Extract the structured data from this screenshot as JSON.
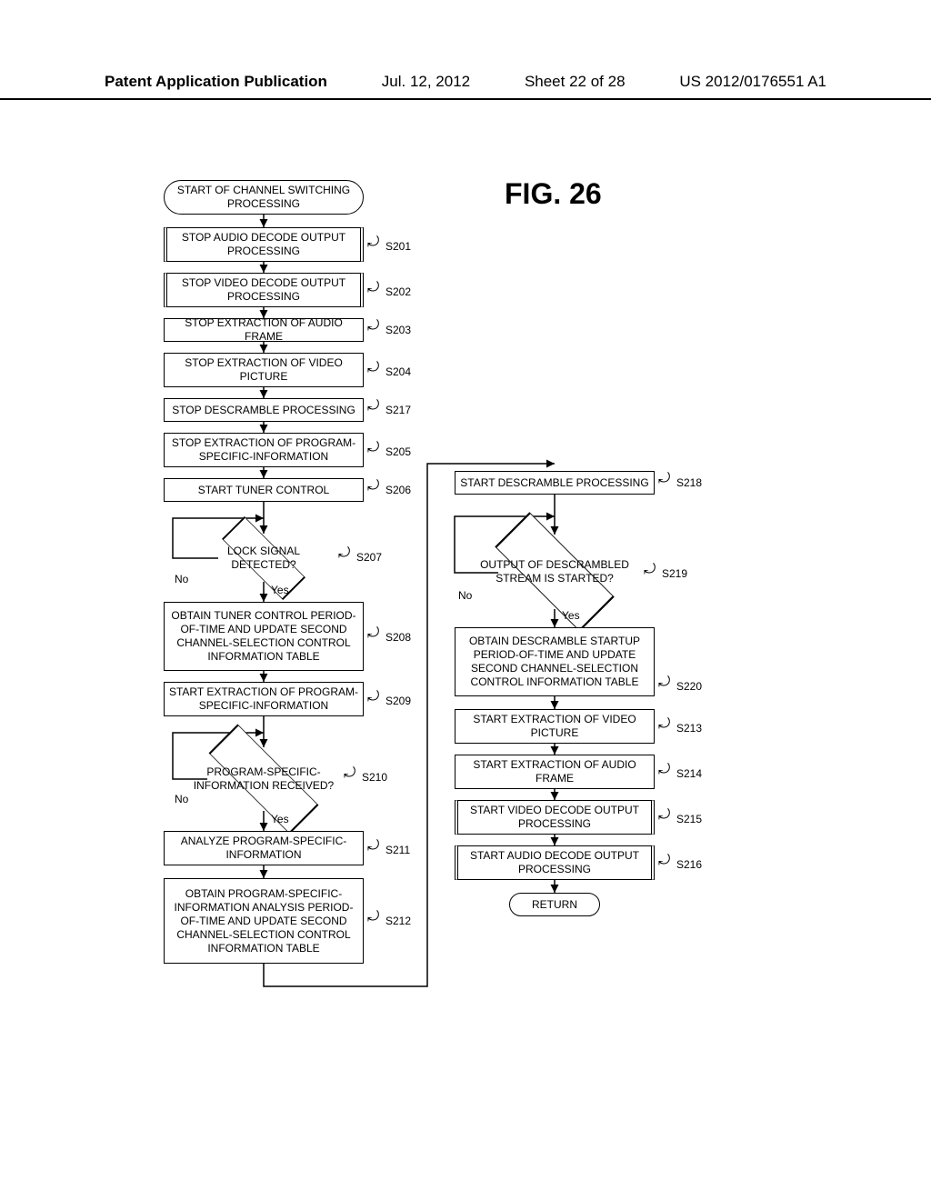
{
  "header": {
    "pub": "Patent Application Publication",
    "date": "Jul. 12, 2012",
    "sheet": "Sheet 22 of 28",
    "docnum": "US 2012/0176551 A1"
  },
  "fig_title": "FIG. 26",
  "terminals": {
    "start": "START OF CHANNEL SWITCHING PROCESSING",
    "return": "RETURN"
  },
  "steps": {
    "s201": {
      "label": "STOP AUDIO DECODE OUTPUT PROCESSING",
      "num": "S201"
    },
    "s202": {
      "label": "STOP VIDEO DECODE OUTPUT PROCESSING",
      "num": "S202"
    },
    "s203": {
      "label": "STOP EXTRACTION OF AUDIO FRAME",
      "num": "S203"
    },
    "s204": {
      "label": "STOP EXTRACTION OF VIDEO PICTURE",
      "num": "S204"
    },
    "s217": {
      "label": "STOP DESCRAMBLE PROCESSING",
      "num": "S217"
    },
    "s205": {
      "label": "STOP EXTRACTION OF PROGRAM-SPECIFIC-INFORMATION",
      "num": "S205"
    },
    "s206": {
      "label": "START TUNER CONTROL",
      "num": "S206"
    },
    "s207": {
      "label": "LOCK SIGNAL DETECTED?",
      "num": "S207"
    },
    "s208": {
      "label": "OBTAIN TUNER CONTROL PERIOD-OF-TIME AND UPDATE SECOND CHANNEL-SELECTION CONTROL INFORMATION TABLE",
      "num": "S208"
    },
    "s209": {
      "label": "START EXTRACTION OF PROGRAM-SPECIFIC-INFORMATION",
      "num": "S209"
    },
    "s210": {
      "label": "PROGRAM-SPECIFIC-INFORMATION RECEIVED?",
      "num": "S210"
    },
    "s211": {
      "label": "ANALYZE PROGRAM-SPECIFIC-INFORMATION",
      "num": "S211"
    },
    "s212": {
      "label": "OBTAIN PROGRAM-SPECIFIC-INFORMATION ANALYSIS PERIOD-OF-TIME AND UPDATE SECOND CHANNEL-SELECTION CONTROL INFORMATION TABLE",
      "num": "S212"
    },
    "s218": {
      "label": "START DESCRAMBLE PROCESSING",
      "num": "S218"
    },
    "s219": {
      "label": "OUTPUT OF DESCRAMBLED STREAM IS STARTED?",
      "num": "S219"
    },
    "s220": {
      "label": "OBTAIN DESCRAMBLE STARTUP PERIOD-OF-TIME AND UPDATE SECOND CHANNEL-SELECTION CONTROL INFORMATION TABLE",
      "num": "S220"
    },
    "s213": {
      "label": "START EXTRACTION OF VIDEO PICTURE",
      "num": "S213"
    },
    "s214": {
      "label": "START EXTRACTION OF AUDIO FRAME",
      "num": "S214"
    },
    "s215": {
      "label": "START VIDEO DECODE OUTPUT PROCESSING",
      "num": "S215"
    },
    "s216": {
      "label": "START AUDIO DECODE OUTPUT PROCESSING",
      "num": "S216"
    }
  },
  "yn": {
    "yes": "Yes",
    "no": "No"
  },
  "chart_data": {
    "type": "flowchart",
    "title": "FIG. 26 — Channel switching processing",
    "nodes": [
      {
        "id": "START",
        "shape": "terminal",
        "label": "START OF CHANNEL SWITCHING PROCESSING"
      },
      {
        "id": "S201",
        "shape": "subroutine",
        "label": "STOP AUDIO DECODE OUTPUT PROCESSING"
      },
      {
        "id": "S202",
        "shape": "subroutine",
        "label": "STOP VIDEO DECODE OUTPUT PROCESSING"
      },
      {
        "id": "S203",
        "shape": "process",
        "label": "STOP EXTRACTION OF AUDIO FRAME"
      },
      {
        "id": "S204",
        "shape": "process",
        "label": "STOP EXTRACTION OF VIDEO PICTURE"
      },
      {
        "id": "S217",
        "shape": "process",
        "label": "STOP DESCRAMBLE PROCESSING"
      },
      {
        "id": "S205",
        "shape": "process",
        "label": "STOP EXTRACTION OF PROGRAM-SPECIFIC-INFORMATION"
      },
      {
        "id": "S206",
        "shape": "process",
        "label": "START TUNER CONTROL"
      },
      {
        "id": "S207",
        "shape": "decision",
        "label": "LOCK SIGNAL DETECTED?"
      },
      {
        "id": "S208",
        "shape": "process",
        "label": "OBTAIN TUNER CONTROL PERIOD-OF-TIME AND UPDATE SECOND CHANNEL-SELECTION CONTROL INFORMATION TABLE"
      },
      {
        "id": "S209",
        "shape": "process",
        "label": "START EXTRACTION OF PROGRAM-SPECIFIC-INFORMATION"
      },
      {
        "id": "S210",
        "shape": "decision",
        "label": "PROGRAM-SPECIFIC-INFORMATION RECEIVED?"
      },
      {
        "id": "S211",
        "shape": "process",
        "label": "ANALYZE PROGRAM-SPECIFIC-INFORMATION"
      },
      {
        "id": "S212",
        "shape": "process",
        "label": "OBTAIN PROGRAM-SPECIFIC-INFORMATION ANALYSIS PERIOD-OF-TIME AND UPDATE SECOND CHANNEL-SELECTION CONTROL INFORMATION TABLE"
      },
      {
        "id": "S218",
        "shape": "process",
        "label": "START DESCRAMBLE PROCESSING"
      },
      {
        "id": "S219",
        "shape": "decision",
        "label": "OUTPUT OF DESCRAMBLED STREAM IS STARTED?"
      },
      {
        "id": "S220",
        "shape": "process",
        "label": "OBTAIN DESCRAMBLE STARTUP PERIOD-OF-TIME AND UPDATE SECOND CHANNEL-SELECTION CONTROL INFORMATION TABLE"
      },
      {
        "id": "S213",
        "shape": "process",
        "label": "START EXTRACTION OF VIDEO PICTURE"
      },
      {
        "id": "S214",
        "shape": "process",
        "label": "START EXTRACTION OF AUDIO FRAME"
      },
      {
        "id": "S215",
        "shape": "subroutine",
        "label": "START VIDEO DECODE OUTPUT PROCESSING"
      },
      {
        "id": "S216",
        "shape": "subroutine",
        "label": "START AUDIO DECODE OUTPUT PROCESSING"
      },
      {
        "id": "RETURN",
        "shape": "terminal",
        "label": "RETURN"
      }
    ],
    "edges": [
      {
        "from": "START",
        "to": "S201"
      },
      {
        "from": "S201",
        "to": "S202"
      },
      {
        "from": "S202",
        "to": "S203"
      },
      {
        "from": "S203",
        "to": "S204"
      },
      {
        "from": "S204",
        "to": "S217"
      },
      {
        "from": "S217",
        "to": "S205"
      },
      {
        "from": "S205",
        "to": "S206"
      },
      {
        "from": "S206",
        "to": "S207"
      },
      {
        "from": "S207",
        "to": "S208",
        "label": "Yes"
      },
      {
        "from": "S207",
        "to": "S207",
        "label": "No"
      },
      {
        "from": "S208",
        "to": "S209"
      },
      {
        "from": "S209",
        "to": "S210"
      },
      {
        "from": "S210",
        "to": "S211",
        "label": "Yes"
      },
      {
        "from": "S210",
        "to": "S210",
        "label": "No"
      },
      {
        "from": "S211",
        "to": "S212"
      },
      {
        "from": "S212",
        "to": "S218"
      },
      {
        "from": "S218",
        "to": "S219"
      },
      {
        "from": "S219",
        "to": "S220",
        "label": "Yes"
      },
      {
        "from": "S219",
        "to": "S219",
        "label": "No"
      },
      {
        "from": "S220",
        "to": "S213"
      },
      {
        "from": "S213",
        "to": "S214"
      },
      {
        "from": "S214",
        "to": "S215"
      },
      {
        "from": "S215",
        "to": "S216"
      },
      {
        "from": "S216",
        "to": "RETURN"
      }
    ]
  }
}
